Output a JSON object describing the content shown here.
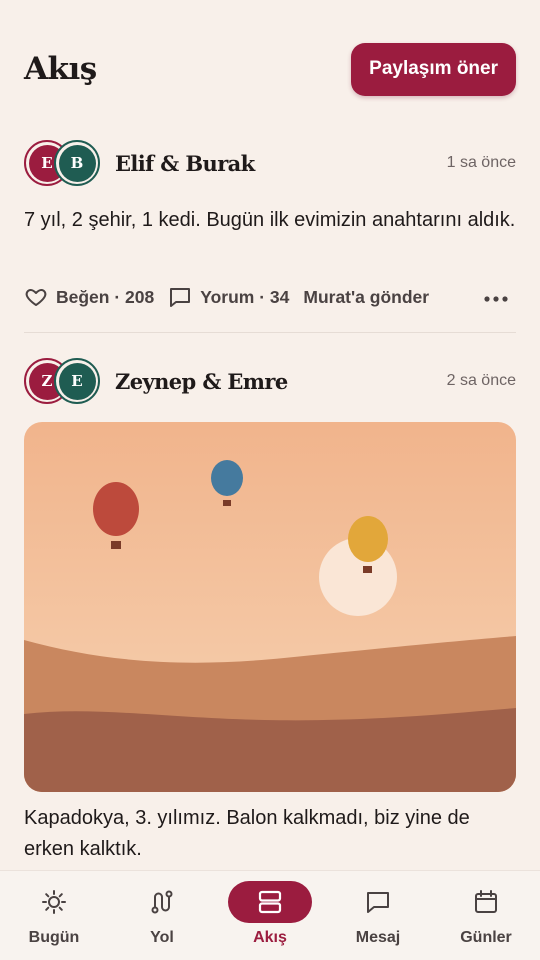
{
  "header": {
    "title": "Akış",
    "suggest_button": "Paylaşım öner"
  },
  "colors": {
    "accent": "#9b1c3f",
    "teal": "#1f5c52",
    "background": "#f8f0ea"
  },
  "posts": [
    {
      "avatars": [
        "E",
        "B"
      ],
      "names": "Elif & Burak",
      "time": "1 sa önce",
      "text": "7 yıl, 2 şehir, 1 kedi. Bugün ilk evimizin anahtarını aldık.",
      "like": "Beğen · 208",
      "comment": "Yorum · 34",
      "send": "Murat'a gönder"
    },
    {
      "avatars": [
        "Z",
        "E"
      ],
      "names": "Zeynep & Emre",
      "time": "2 sa önce",
      "image": "hot-air-balloons-illustration",
      "text": "Kapadokya, 3. yılımız. Balon kalkmadı, biz yine de erken kalktık."
    }
  ],
  "tabbar": {
    "tabs": [
      {
        "label": "Bugün",
        "icon": "sun-icon"
      },
      {
        "label": "Yol",
        "icon": "route-icon"
      },
      {
        "label": "Akış",
        "icon": "feed-icon",
        "active": true
      },
      {
        "label": "Mesaj",
        "icon": "message-icon"
      },
      {
        "label": "Günler",
        "icon": "calendar-icon"
      }
    ]
  }
}
